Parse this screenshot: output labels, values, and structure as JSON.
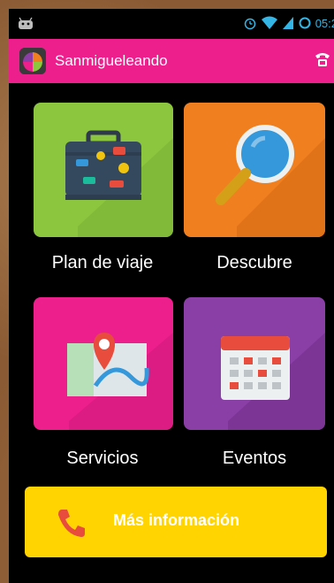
{
  "status_bar": {
    "time": "05:2",
    "icons": [
      "alarm-icon",
      "wifi-icon",
      "signal-icon",
      "sync-icon"
    ],
    "left_icon": "android-icon"
  },
  "action_bar": {
    "title": "Sanmigueleando",
    "app_icon": "app-logo-icon",
    "right_icon": "phone-icon",
    "color": "#ec1f8c"
  },
  "tiles": [
    {
      "label": "Plan de viaje",
      "icon": "suitcase-icon",
      "color": "#8cc63f"
    },
    {
      "label": "Descubre",
      "icon": "magnifier-icon",
      "color": "#f07f1f"
    },
    {
      "label": "Servicios",
      "icon": "map-pin-icon",
      "color": "#ec1f8c"
    },
    {
      "label": "Eventos",
      "icon": "calendar-icon",
      "color": "#8a3fa6"
    }
  ],
  "more_info": {
    "label": "Más información",
    "icon": "phone-call-icon",
    "color": "#ffd400"
  }
}
